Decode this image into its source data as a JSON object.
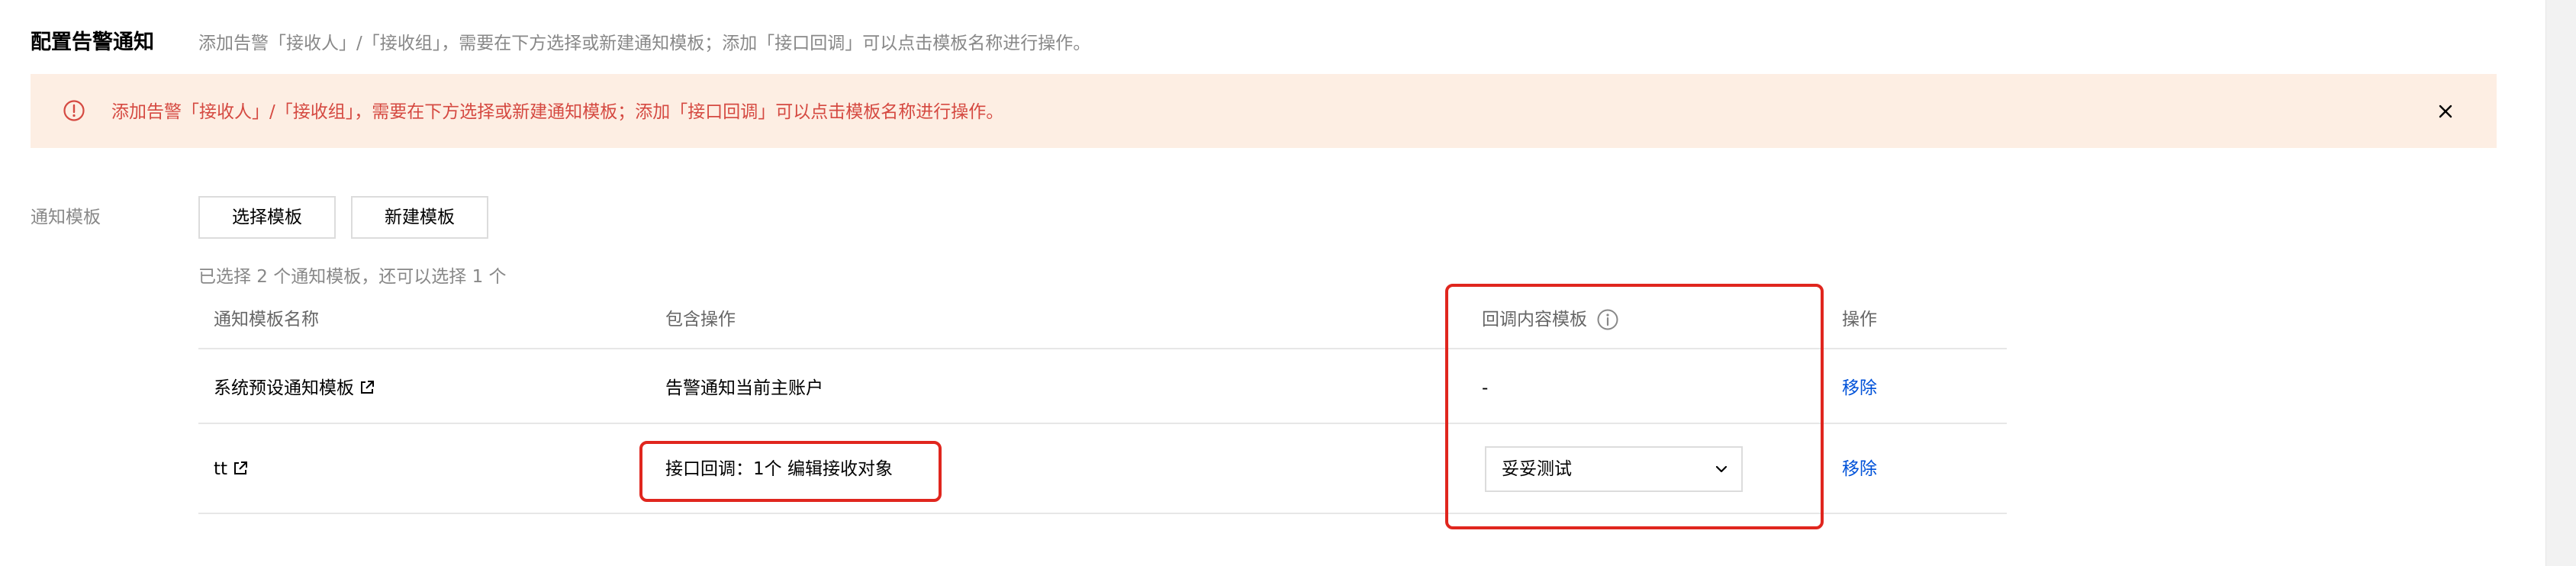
{
  "header": {
    "title": "配置告警通知",
    "description": "添加告警「接收人」/「接收组」，需要在下方选择或新建通知模板；添加「接口回调」可以点击模板名称进行操作。"
  },
  "alert": {
    "text": "添加告警「接收人」/「接收组」，需要在下方选择或新建通知模板；添加「接口回调」可以点击模板名称进行操作。",
    "icon": "warning-circle-icon",
    "close_icon": "close-icon",
    "bg_color": "#fdeee3",
    "text_color": "#d54941"
  },
  "form": {
    "label": "通知模板",
    "select_button": "选择模板",
    "new_button": "新建模板",
    "hint": "已选择 2 个通知模板，还可以选择 1 个"
  },
  "table": {
    "columns": [
      "通知模板名称",
      "包含操作",
      "回调内容模板",
      "操作"
    ],
    "rows": [
      {
        "name": "系统预设通知模板",
        "actions": "告警通知当前主账户",
        "callback": "-",
        "op": "移除"
      },
      {
        "name": "tt",
        "actions": "接口回调：1个  编辑接收对象",
        "callback_select": "妥妥测试",
        "op": "移除"
      }
    ]
  },
  "colors": {
    "link": "#0052d9",
    "annotation": "#e0261e"
  }
}
